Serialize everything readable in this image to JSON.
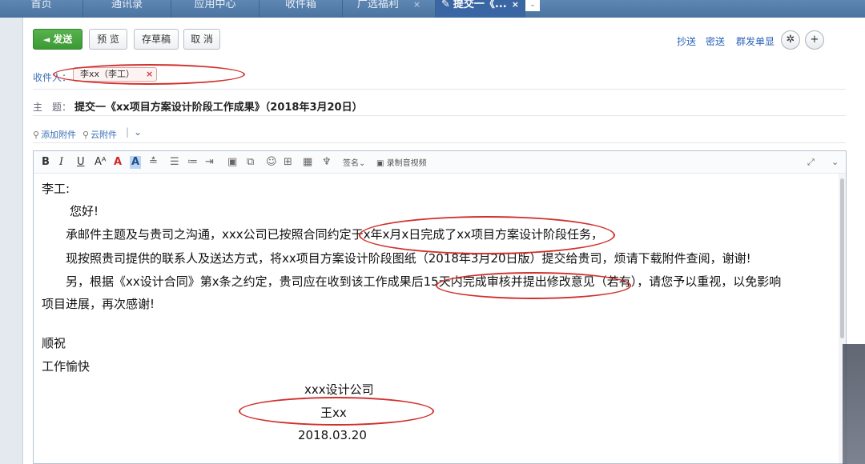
{
  "tabs": [
    {
      "label": "首页"
    },
    {
      "label": "通讯录"
    },
    {
      "label": "应用中心"
    },
    {
      "label": "收件箱"
    },
    {
      "label": "广选福利"
    },
    {
      "label": "提交一《...",
      "close": "×"
    }
  ],
  "tab_close": "×",
  "tab_overflow": "⌄",
  "toolbar": {
    "send_label": "发送",
    "preview_label": "预 览",
    "draft_label": "存草稿",
    "cancel_label": "取 消"
  },
  "header_links": {
    "cc_label": "抄送",
    "bcc_label": "密送",
    "group_label": "群发单显"
  },
  "recipients": {
    "label": "收件人：",
    "chips": [
      {
        "name": "李xx（李工）",
        "remove": "×"
      }
    ]
  },
  "subject": {
    "label": "主　题：",
    "value": "提交一《xx项目方案设计阶段工作成果》（2018年3月20日）"
  },
  "attachments": {
    "add_label": "添加附件",
    "cloud_label": "云附件",
    "separator": "|",
    "more": "⌄"
  },
  "editor_toolbar": {
    "bold": "B",
    "italic": "I",
    "underline": "U",
    "font_size": "Aᴬ",
    "font_color": "A",
    "bg_color": "A",
    "signature_label": "签名",
    "signature_caret": "⌄",
    "record_label": "录制音视频"
  },
  "email_body": {
    "greeting": "李工:",
    "salutation": "您好!",
    "para1": "承邮件主题及与贵司之沟通，xxx公司已按照合同约定于x年x月x日完成了xx项目方案设计阶段任务，",
    "para2": "现按照贵司提供的联系人及送达方式，将xx项目方案设计阶段图纸（2018年3月20日版）提交给贵司，烦请下载附件查阅，谢谢!",
    "para3a": "另，根据《xx设计合同》第x条之约定，贵司应在收到该工作成果后15天内完成审核并提出修改意见（若有），请您予以重视，以免影响",
    "para3b": "项目进展，再次感谢!",
    "closing1": "顺祝",
    "closing2": "工作愉快",
    "sign_company": "xxx设计公司",
    "sign_name": "王xx",
    "sign_date": "2018.03.20"
  },
  "colors": {
    "accent_blue": "#2a62b6",
    "send_green": "#3b9a33",
    "highlight_red": "#d0302c",
    "tab_bar": "#4a73a0"
  }
}
